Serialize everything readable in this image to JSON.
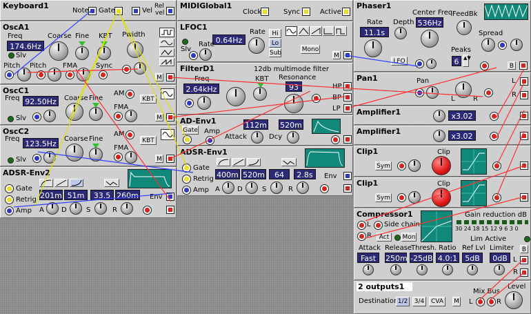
{
  "colors": {
    "bg": "#8e8e8e",
    "module": "#cfcfcf",
    "display": "#2c2a78",
    "cable_red": "#ff3030",
    "cable_blue": "#3040ff",
    "cable_yellow": "#e0e000",
    "scope": "#10897a"
  },
  "keyboard": {
    "title": "Keyboard1",
    "note": "Note",
    "gate": "Gate",
    "vel": "Vel",
    "relvel1": "Rel",
    "relvel2": "vel"
  },
  "midiglobal": {
    "title": "MIDIGlobal1",
    "clock": "Clock",
    "sync": "Sync",
    "active": "Active"
  },
  "phaser": {
    "title": "Phaser1",
    "rate_label": "Rate",
    "rate": "11.1s",
    "depth": "Depth",
    "center_label": "Center Freq",
    "center": "536Hz",
    "feedbk": "FeedBk",
    "peaks_label": "Peaks",
    "peaks": "6",
    "spread": "Spread",
    "lfo": "LFO",
    "b": "B"
  },
  "osca1": {
    "title": "OscA1",
    "freq_label": "Freq",
    "freq": "174.6Hz",
    "coarse": "Coarse",
    "fine": "Fine",
    "kbt": "KBT",
    "slv": "Slv",
    "pwidth": "Pwidth",
    "pitch1": "Pitch",
    "pitch2": "Pitch",
    "fma": "FMA",
    "sync": "Sync",
    "m": "M"
  },
  "lfoc1": {
    "title": "LFOC1",
    "rate_label": "Rate",
    "rate": "0.64Hz",
    "hi": "Hi",
    "lo": "Lo",
    "sub": "Sub",
    "slv": "Slv",
    "mono": "Mono",
    "m": "M"
  },
  "filterd1": {
    "title": "FilterD1",
    "subtitle": "12db multimode filter",
    "freq_label": "Freq",
    "freq": "2.64kHz",
    "kbt": "KBT",
    "resonance": "Resonance",
    "res": "93",
    "hp": "HP",
    "bp": "BP",
    "lp": "LP"
  },
  "oscc1": {
    "title": "OscC1",
    "freq_label": "Freq",
    "freq": "92.50Hz",
    "coarse": "Coarse",
    "fine": "Fine",
    "am": "AM",
    "kbt": "KBT",
    "fma": "FMA",
    "slv": "Slv",
    "m": "M"
  },
  "osc c2": {},
  "oscc2": {
    "title": "OscC2",
    "freq_label": "Freq",
    "freq": "123.5Hz",
    "coarse": "Coarse",
    "fine": "Fine",
    "am": "AM",
    "kbt": "KBT",
    "fma": "FMA",
    "slv": "Slv",
    "m": "M"
  },
  "adenv1": {
    "title": "AD-Env1",
    "gate": "Gate",
    "amp": "Amp",
    "attack_label": "Attack",
    "attack": "112m",
    "dcy_label": "Dcy",
    "decay": "520m"
  },
  "adsrenv1": {
    "title": "ADSR-Env1",
    "gate": "Gate",
    "retrig": "Retrig",
    "amp": "Amp",
    "a": "400m",
    "d": "520m",
    "s": "64",
    "r": "2.8s",
    "la": "A",
    "ld": "D",
    "ls": "S",
    "lr": "R",
    "env": "Env"
  },
  "adsrenv2": {
    "title": "ADSR-Env2",
    "gate": "Gate",
    "retrig": "Retrig",
    "amp": "Amp",
    "a": "201m",
    "d": "51m",
    "s": "33.5",
    "r": "260m",
    "la": "A",
    "ld": "D",
    "ls": "S",
    "lr": "R",
    "env": "Env"
  },
  "pan1": {
    "title": "Pan1",
    "pan": "Pan",
    "l": "L",
    "r": "R"
  },
  "amp1": {
    "title": "Amplifier1",
    "value": "x3.02"
  },
  "amp2": {
    "title": "Amplifier1",
    "value": "x3.02"
  },
  "clip1": {
    "title": "Clip1",
    "sym": "Sym",
    "clip": "Clip"
  },
  "clip2": {
    "title": "Clip1",
    "sym": "Sym",
    "clip": "Clip"
  },
  "comp": {
    "title": "Compressor1",
    "l": "L",
    "r": "R",
    "side": "Side chain",
    "gain_red": "Gain reduction dB",
    "scale": "30 24 18 15 12 9 6 3 0",
    "act": "Act",
    "mon": "Mon",
    "lim_active": "Lim Active",
    "attack_label": "Attack",
    "attack": "Fast",
    "release_label": "Release",
    "release": "250m",
    "thresh_label": "Thresh.",
    "thresh": "-25dB",
    "ratio_label": "Ratio",
    "ratio": "4.0:1",
    "reflvl_label": "Ref Lvl",
    "reflvl": "5dB",
    "limiter_label": "Limiter",
    "limiter": "0dB",
    "b": "B"
  },
  "outputs": {
    "title": "2 outputs1",
    "destination": "Destination",
    "d12": "1/2",
    "d34": "3/4",
    "cva": "CVA",
    "m": "M",
    "mixbus": "Mix Bus",
    "level": "Level",
    "l": "L",
    "r": "R"
  }
}
